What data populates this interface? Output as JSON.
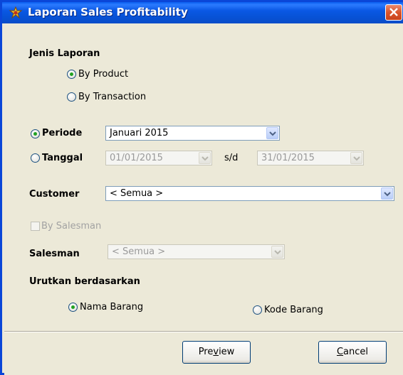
{
  "window": {
    "title": "Laporan Sales Profitability"
  },
  "jenis_laporan": {
    "label": "Jenis Laporan",
    "options": [
      {
        "label": "By Product",
        "checked": true
      },
      {
        "label": "By Transaction",
        "checked": false
      }
    ]
  },
  "periode": {
    "label": "Periode",
    "checked": true,
    "value": "Januari 2015"
  },
  "tanggal": {
    "label": "Tanggal",
    "checked": false,
    "from": "01/01/2015",
    "separator": "s/d",
    "to": "31/01/2015"
  },
  "customer": {
    "label": "Customer",
    "value": "< Semua >"
  },
  "by_salesman": {
    "label": "By Salesman",
    "checked": false
  },
  "salesman": {
    "label": "Salesman",
    "value": "< Semua >"
  },
  "urutkan": {
    "label": "Urutkan berdasarkan",
    "options": [
      {
        "label": "Nama Barang",
        "checked": true
      },
      {
        "label": "Kode Barang",
        "checked": false
      }
    ]
  },
  "buttons": {
    "preview": {
      "pre": "Pre",
      "accel": "v",
      "post": "iew"
    },
    "cancel": {
      "pre": "",
      "accel": "C",
      "post": "ancel"
    }
  },
  "colors": {
    "titlebar": "#0a5ff0",
    "client": "#ece9d8",
    "radio_dot": "#21a121",
    "close": "#d9542c"
  }
}
